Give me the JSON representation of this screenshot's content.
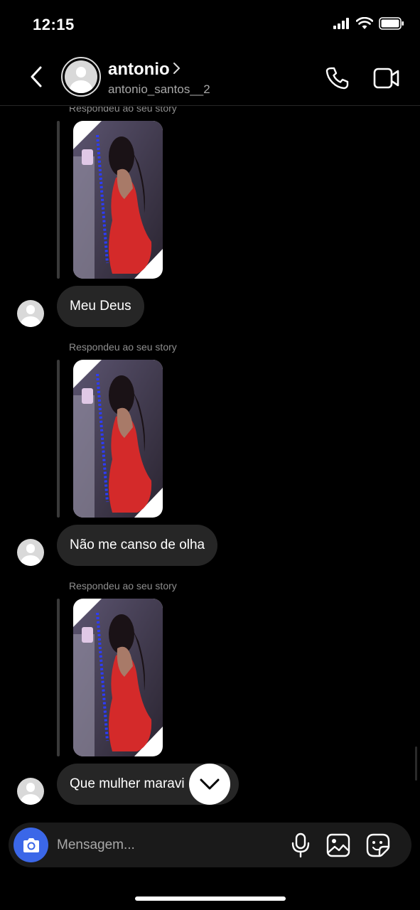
{
  "status_bar": {
    "time": "12:15",
    "icons": [
      "signal-icon",
      "wifi-icon",
      "battery-icon"
    ]
  },
  "header": {
    "back_icon": "chevron-left-icon",
    "display_name": "antonio",
    "username": "antonio_santos__2",
    "name_chevron": "chevron-right-icon",
    "call_icon": "phone-icon",
    "video_icon": "video-camera-icon"
  },
  "messages": [
    {
      "reply_label": "Respondeu ao seu story",
      "text": "Meu Deus"
    },
    {
      "reply_label": "Respondeu ao seu story",
      "text": "Não me canso de olha"
    },
    {
      "reply_label": "Respondeu ao seu story",
      "text": "Que mulher maravi"
    }
  ],
  "scroll_down_icon": "chevron-down-icon",
  "composer": {
    "placeholder": "Mensagem...",
    "camera_icon": "camera-icon",
    "mic_icon": "microphone-icon",
    "gallery_icon": "image-icon",
    "sticker_icon": "sticker-icon"
  },
  "colors": {
    "background": "#000000",
    "bubble": "#262626",
    "camera_button": "#3b67e8",
    "secondary_text": "#8e8e8e"
  }
}
